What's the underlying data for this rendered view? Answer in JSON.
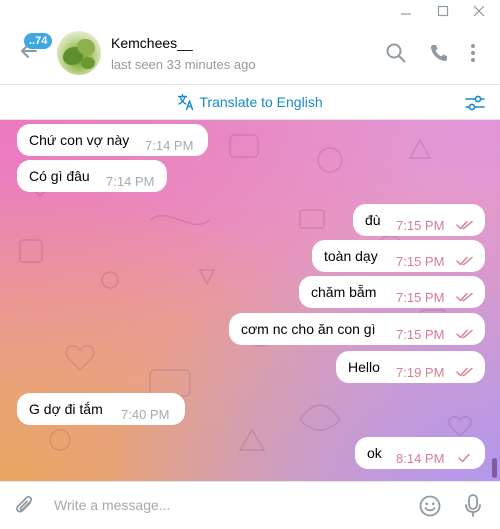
{
  "window": {
    "minimize_icon": "minimize-icon",
    "maximize_icon": "maximize-icon",
    "close_icon": "close-icon"
  },
  "header": {
    "unread_badge": "..74",
    "contact_name": "Kemchees__",
    "status": "last seen 33 minutes ago",
    "icons": [
      "back-arrow-icon",
      "search-icon",
      "phone-icon",
      "more-vertical-icon"
    ]
  },
  "translate_bar": {
    "label": "Translate to English",
    "icons": [
      "translate-icon",
      "settings-sliders-icon"
    ]
  },
  "messages": [
    {
      "direction": "in",
      "text": "Chứ con vợ này",
      "time": "7:14 PM"
    },
    {
      "direction": "in",
      "text": "Có gì đâu",
      "time": "7:14 PM"
    },
    {
      "direction": "out",
      "text": "đù",
      "time": "7:15 PM",
      "read": true
    },
    {
      "direction": "out",
      "text": "toàn dạy",
      "time": "7:15 PM",
      "read": true
    },
    {
      "direction": "out",
      "text": "chăm bẵm",
      "time": "7:15 PM",
      "read": true
    },
    {
      "direction": "out",
      "text": "cơm nc cho ăn con gì",
      "time": "7:15 PM",
      "read": true
    },
    {
      "direction": "out",
      "text": "Hello",
      "time": "7:19 PM",
      "read": true
    },
    {
      "direction": "in",
      "text": "G dợ đi tắm",
      "time": "7:40 PM"
    },
    {
      "direction": "out",
      "text": "ok",
      "time": "8:14 PM",
      "read": false
    }
  ],
  "composer": {
    "placeholder": "Write a message...",
    "icons": [
      "paperclip-icon",
      "emoji-icon",
      "microphone-icon"
    ]
  },
  "colors": {
    "accent": "#168acd",
    "badge": "#40a7e3",
    "outgoing_time": "#d47e92",
    "incoming_time": "#a0acb6"
  }
}
